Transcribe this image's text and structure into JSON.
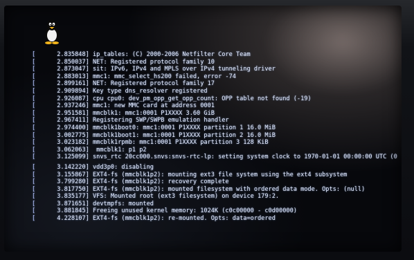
{
  "console": {
    "lines": [
      {
        "ts": "2.835848]",
        "msg": "ip_tables: (C) 2000-2006 Netfilter Core Team"
      },
      {
        "ts": "2.850037]",
        "msg": "NET: Registered protocol family 10"
      },
      {
        "ts": "2.873047]",
        "msg": "sit: IPv6, IPv4 and MPLS over IPv4 tunneling driver"
      },
      {
        "ts": "2.883013]",
        "msg": "mmc1: mmc_select_hs200 failed, error -74"
      },
      {
        "ts": "2.899161]",
        "msg": "NET: Registered protocol family 17"
      },
      {
        "ts": "2.909894]",
        "msg": "Key type dns_resolver registered"
      },
      {
        "ts": "2.926087]",
        "msg": "cpu cpu0: dev_pm_opp_get_opp_count: OPP table not found (-19)"
      },
      {
        "ts": "2.937246]",
        "msg": "mmc1: new MMC card at address 0001"
      },
      {
        "ts": "2.951581]",
        "msg": "mmcblk1: mmc1:0001 P1XXXX 3.60 GiB"
      },
      {
        "ts": "2.967411]",
        "msg": "Registering SWP/SWPB emulation handler"
      },
      {
        "ts": "2.974400]",
        "msg": "mmcblk1boot0: mmc1:0001 P1XXXX partition 1 16.0 MiB"
      },
      {
        "ts": "3.002775]",
        "msg": "mmcblk1boot1: mmc1:0001 P1XXXX partition 2 16.0 MiB"
      },
      {
        "ts": "3.023182]",
        "msg": "mmcblk1rpmb: mmc1:0001 P1XXXX partition 3 128 KiB"
      },
      {
        "ts": "3.062063]",
        "msg": " mmcblk1: p1 p2"
      },
      {
        "ts": "3.125099]",
        "msg": "snvs_rtc 20cc000.snvs:snvs-rtc-lp: setting system clock to 1970-01-01 00:00:00 UTC (0"
      },
      {
        "ts": "",
        "msg": ""
      },
      {
        "ts": "3.142220]",
        "msg": "vdd3p0: disabling"
      },
      {
        "ts": "3.155867]",
        "msg": "EXT4-fs (mmcblk1p2): mounting ext3 file system using the ext4 subsystem"
      },
      {
        "ts": "3.799280]",
        "msg": "EXT4-fs (mmcblk1p2): recovery complete"
      },
      {
        "ts": "3.817750]",
        "msg": "EXT4-fs (mmcblk1p2): mounted filesystem with ordered data mode. Opts: (null)"
      },
      {
        "ts": "3.835177]",
        "msg": "VFS: Mounted root (ext3 filesystem) on device 179:2."
      },
      {
        "ts": "3.871651]",
        "msg": "devtmpfs: mounted"
      },
      {
        "ts": "3.881845]",
        "msg": "Freeing unused kernel memory: 1024K (c0c00000 - c0d00000)"
      },
      {
        "ts": "4.228107]",
        "msg": "EXT4-fs (mmcblk1p2): re-mounted. Opts: data=ordered"
      }
    ]
  },
  "icons": {
    "boot_logo": "tux-penguin-icon"
  },
  "colors": {
    "text": "#e7ecff",
    "screen_bg": "#07080c"
  }
}
